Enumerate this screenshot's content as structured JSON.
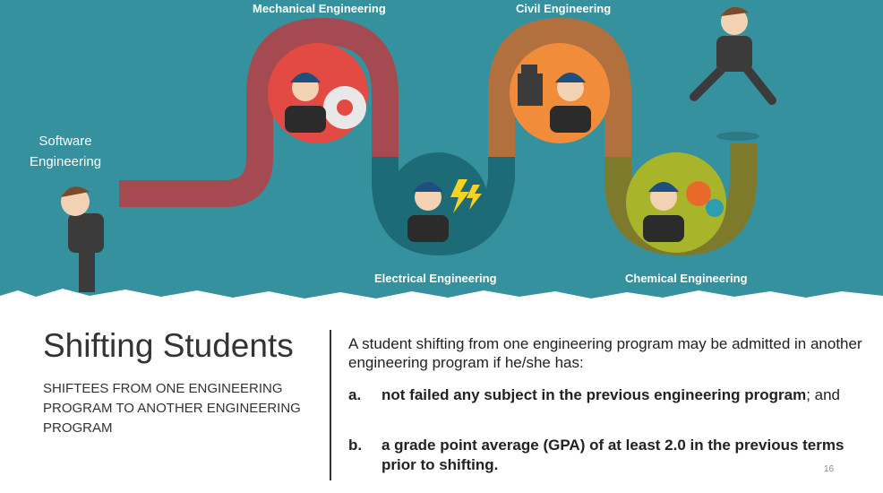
{
  "banner": {
    "labels": {
      "software": "Software\nEngineering",
      "mechanical": "Mechanical Engineering",
      "civil": "Civil Engineering",
      "electrical": "Electrical Engineering",
      "chemical": "Chemical Engineering"
    },
    "colors": {
      "background": "#36919f",
      "mechanical": "#e24a43",
      "electrical": "#1e6b78",
      "civil": "#f18c3a",
      "chemical": "#a8b52b",
      "pipe_red": "#a54a50",
      "pipe_teal": "#1e6b78",
      "pipe_orange": "#b3703f",
      "pipe_olive": "#7e7a2c"
    }
  },
  "content": {
    "title": "Shifting Students",
    "subtitle": "SHIFTEES FROM ONE ENGINEERING PROGRAM TO ANOTHER ENGINEERING PROGRAM",
    "intro": "A student shifting from one engineering program may be admitted in another engineering program if he/she has:",
    "items": [
      {
        "marker": "a.",
        "bold": "not failed any subject in the previous engineering program",
        "rest": "; and"
      },
      {
        "marker": "b.",
        "bold": "a grade point average (GPA) of at least 2.0 in the previous terms prior to shifting.",
        "rest": ""
      }
    ],
    "page_number": "16"
  }
}
